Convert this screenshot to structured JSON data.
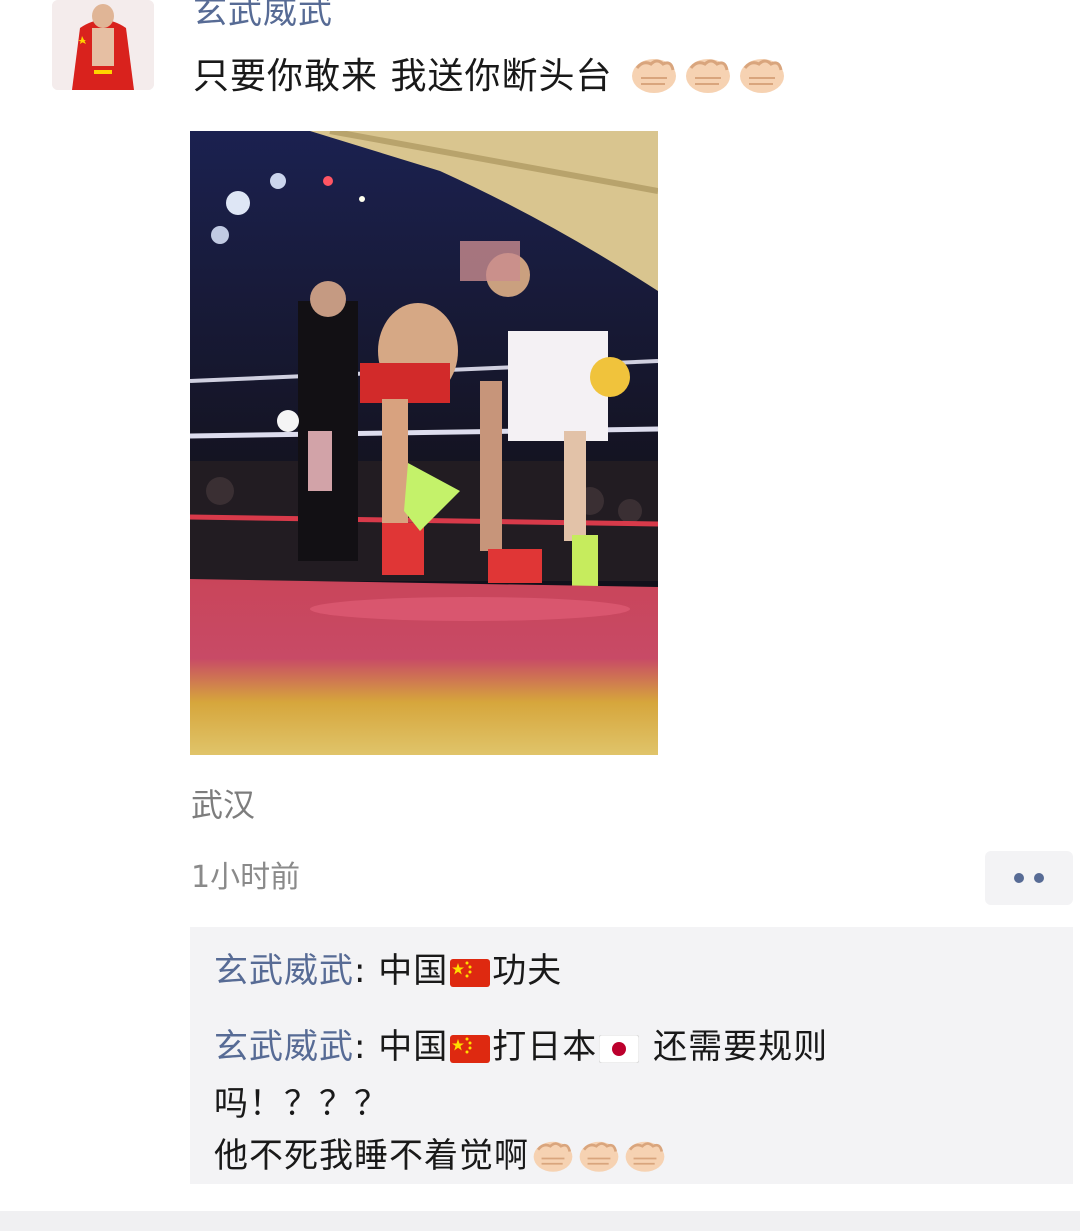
{
  "post": {
    "author": "玄武威武",
    "text": "只要你敢来 我送你断头台",
    "text_emoji": "fist-bump-icon x3",
    "location": "武汉",
    "time": "1小时前"
  },
  "comments": [
    {
      "author": "玄武威武",
      "sep": ": ",
      "parts": [
        "中国",
        "功夫"
      ]
    },
    {
      "author": "玄武威武",
      "sep": ": ",
      "parts": [
        "中国",
        "打日本",
        " 还需要规则"
      ],
      "line2": "吗！？？？",
      "line3": "他不死我睡不着觉啊"
    }
  ],
  "colors": {
    "author_link": "#576b95",
    "comment_bg": "#f3f3f5",
    "secondary_text": "#8a8a8a"
  },
  "icons": [
    "fist-bump-icon",
    "china-flag-icon",
    "japan-flag-icon",
    "more-dots-icon"
  ]
}
